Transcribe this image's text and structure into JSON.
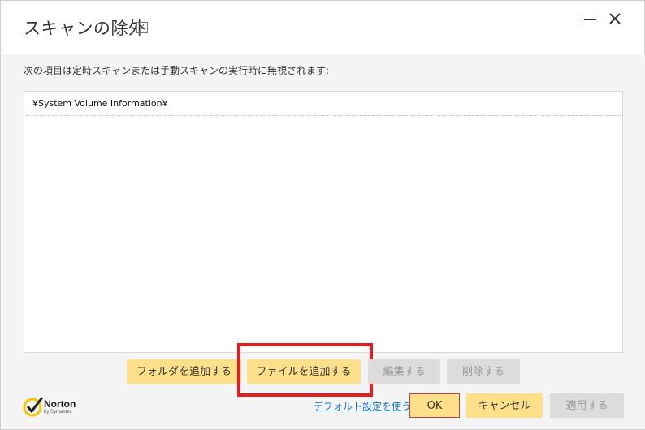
{
  "window": {
    "title": "スキャンの除外",
    "help_icon": "?"
  },
  "content": {
    "instruction": "次の項目は定時スキャンまたは手動スキャンの実行時に無視されます:",
    "exclusions": [
      "¥System Volume Information¥"
    ]
  },
  "actions": {
    "add_folder": "フォルダを追加する",
    "add_file": "ファイルを追加する",
    "edit": "編集する",
    "delete": "削除する"
  },
  "footer": {
    "brand": "Norton",
    "brand_sub": "by Symantec",
    "restore_defaults": "デフォルト設定を使う",
    "ok": "OK",
    "cancel": "キャンセル",
    "apply": "適用する"
  },
  "colors": {
    "accent_button": "#ffe08a",
    "disabled_button": "#dcdcdc",
    "highlight": "#e02020",
    "link": "#1a73c8",
    "norton_yellow": "#f5c400"
  }
}
